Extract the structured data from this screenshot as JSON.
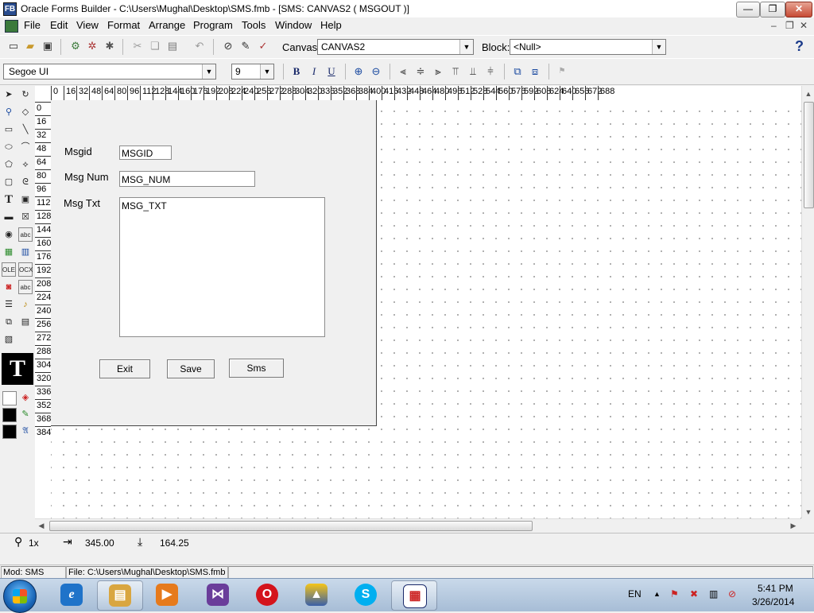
{
  "window": {
    "title": "Oracle Forms Builder - C:\\Users\\Mughal\\Desktop\\SMS.fmb - [SMS: CANVAS2 ( MSGOUT )]",
    "app_icon_text": "FB",
    "minimize_glyph": "—",
    "maximize_glyph": "❐",
    "close_glyph": "✕"
  },
  "menu": {
    "items": [
      "File",
      "Edit",
      "View",
      "Format",
      "Arrange",
      "Program",
      "Tools",
      "Window",
      "Help"
    ],
    "mdi_min": "–",
    "mdi_restore": "❐",
    "mdi_close": "✕"
  },
  "toolbar1": {
    "canvas_label": "Canvas:",
    "canvas_value": "CANVAS2",
    "block_label": "Block:",
    "block_value": "<Null>",
    "help_glyph": "?"
  },
  "toolbar2": {
    "font_value": "Segoe UI",
    "size_value": "9",
    "bold": "B",
    "italic": "I",
    "underline": "U"
  },
  "ruler": {
    "h_ticks": [
      "0",
      "16",
      "32",
      "48",
      "64",
      "80",
      "96",
      "112",
      "128",
      "144",
      "160",
      "176",
      "192",
      "208",
      "224",
      "240",
      "256",
      "272",
      "288",
      "304",
      "320",
      "336",
      "352",
      "368",
      "384",
      "400",
      "416",
      "432",
      "448",
      "464",
      "480",
      "496",
      "512",
      "528",
      "544",
      "560",
      "576",
      "592",
      "608",
      "624",
      "640",
      "656",
      "672",
      "688"
    ],
    "v_ticks": [
      "0",
      "16",
      "32",
      "48",
      "64",
      "80",
      "96",
      "112",
      "128",
      "144",
      "160",
      "176",
      "192",
      "208",
      "224",
      "240",
      "256",
      "272",
      "288",
      "304",
      "320",
      "336",
      "352",
      "368",
      "384"
    ]
  },
  "form": {
    "msgid_label": "Msgid",
    "msgid_item": "MSGID",
    "msgnum_label": "Msg Num",
    "msgnum_item": "MSG_NUM",
    "msgtxt_label": "Msg Txt",
    "msgtxt_item": "MSG_TXT",
    "exit_label": "Exit",
    "save_label": "Save",
    "sms_label": "Sms"
  },
  "palette": {
    "text_tool": "T",
    "abc": "abc",
    "ole": "OLE",
    "ocx": "OCX"
  },
  "status": {
    "zoom": "1x",
    "x_pos": "345.00",
    "y_pos": "164.25",
    "module": "Mod: SMS",
    "file": "File: C:\\Users\\Mughal\\Desktop\\SMS.fmb"
  },
  "taskbar": {
    "language": "EN",
    "time": "5:41 PM",
    "date": "3/26/2014",
    "tray_up": "▲"
  },
  "colors": {
    "ie": "#1f73c9",
    "explorer": "#d9a640",
    "media": "#e67a1c",
    "vs": "#6a3d9a",
    "opera": "#d4141c",
    "oracle": "#2a4d8f",
    "skype": "#00aff0"
  }
}
